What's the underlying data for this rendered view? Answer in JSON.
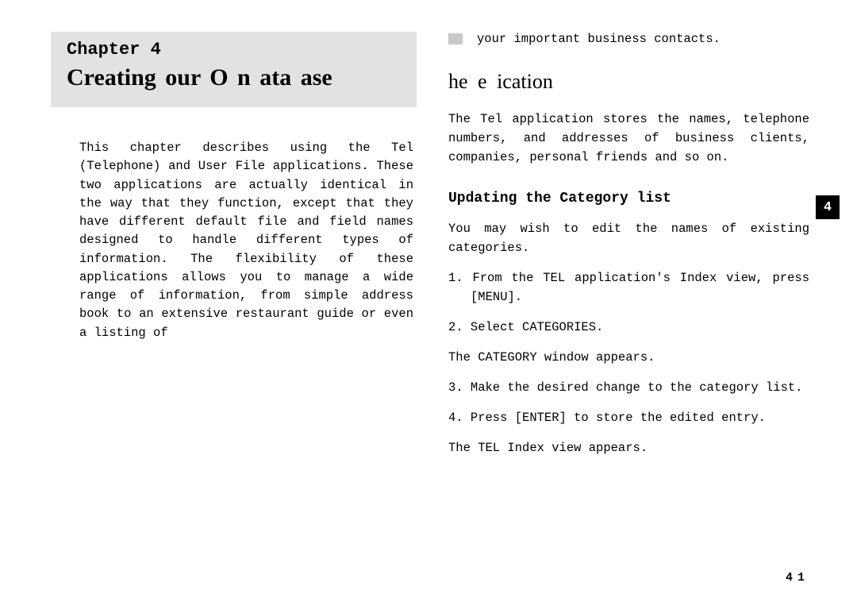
{
  "chapter": {
    "label": "Chapter 4",
    "title": "Creating  our O  n   ata ase",
    "intro": "This chapter describes using the Tel (Telephone) and User File applications. These two applications are actually identical in the way that they function, except that they have different default file and field names designed to handle different types of information. The flexibility of these applications allows you to manage a wide range of information, from simple address book to an extensive restaurant guide or even a listing of"
  },
  "right": {
    "continuation": "your important business contacts.",
    "section_heading": "he  e     ication",
    "tel_intro": "The Tel application stores the names, telephone numbers, and addresses of business clients, companies, personal friends and so on.",
    "sub_heading": "Updating the Category list",
    "sub_intro": "You may wish to edit the names of existing categories.",
    "steps": {
      "s1": "1. From the TEL application's Index view, press [MENU].",
      "s2": "2. Select CATEGORIES.",
      "s2r": "The CATEGORY window appears.",
      "s3": "3. Make the desired change to the category list.",
      "s4": "4. Press [ENTER] to store the edited entry.",
      "s4r": "The TEL Index view appears."
    }
  },
  "page_number": "41",
  "tab_number": "4"
}
